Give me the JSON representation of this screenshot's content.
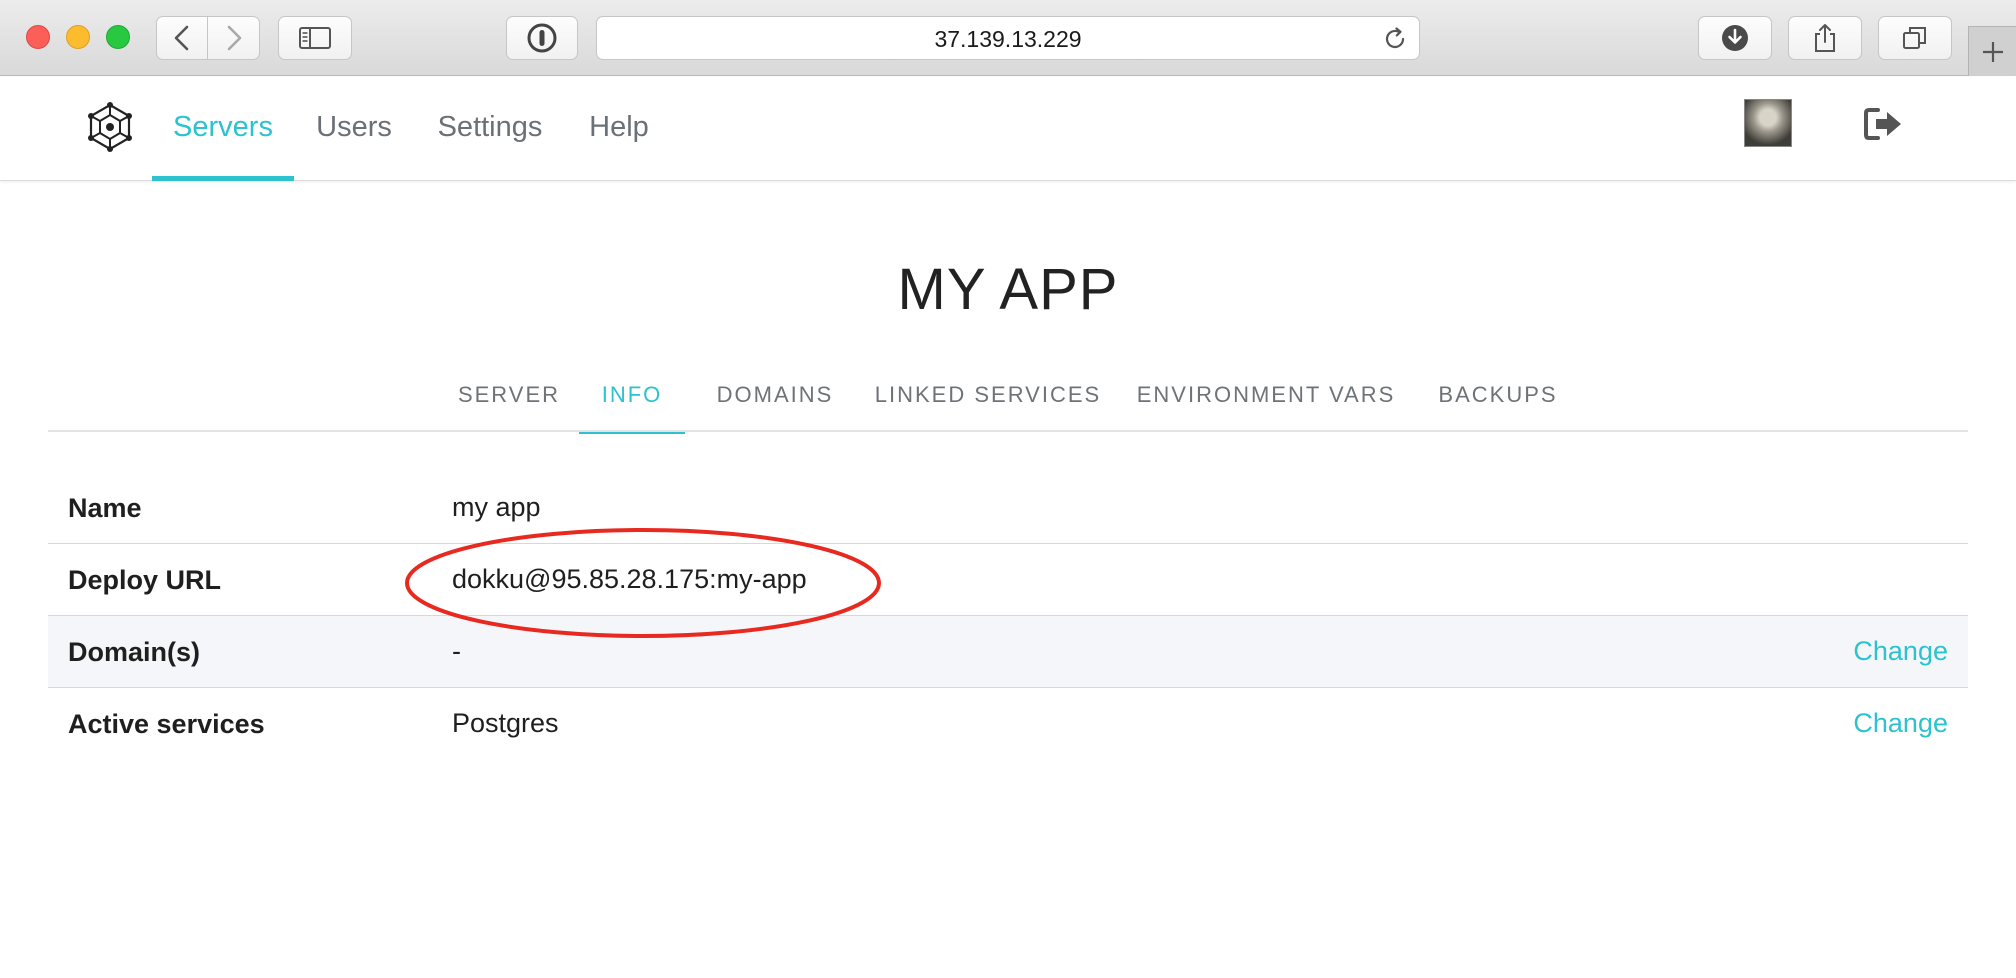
{
  "browser": {
    "url": "37.139.13.229"
  },
  "nav": {
    "items": [
      {
        "label": "Servers",
        "active": true
      },
      {
        "label": "Users",
        "active": false
      },
      {
        "label": "Settings",
        "active": false
      },
      {
        "label": "Help",
        "active": false
      }
    ]
  },
  "page": {
    "title": "MY APP",
    "tabs": [
      {
        "label": "SERVER",
        "active": false
      },
      {
        "label": "INFO",
        "active": true
      },
      {
        "label": "DOMAINS",
        "active": false
      },
      {
        "label": "LINKED SERVICES",
        "active": false
      },
      {
        "label": "ENVIRONMENT VARS",
        "active": false
      },
      {
        "label": "BACKUPS",
        "active": false
      }
    ],
    "info_rows": [
      {
        "label": "Name",
        "value": "my app"
      },
      {
        "label": "Deploy URL",
        "value": "dokku@95.85.28.175:my-app"
      },
      {
        "label": "Domain(s)",
        "value": "-",
        "action": "Change"
      },
      {
        "label": "Active services",
        "value": "Postgres",
        "action": "Change"
      }
    ]
  },
  "colors": {
    "accent": "#2cc2cf",
    "annotation": "#e8291f"
  },
  "icons": {
    "logo": "hexagon-network-logo-icon",
    "logout": "logout-icon"
  }
}
